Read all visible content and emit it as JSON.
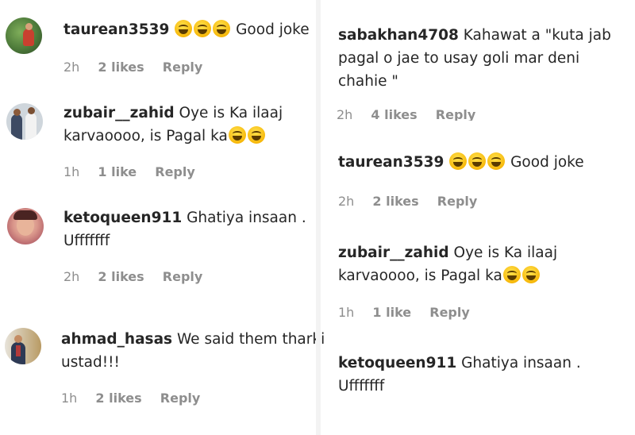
{
  "left": [
    {
      "user": "taurean3539",
      "emojis": 3,
      "text": "Good joke",
      "time": "2h",
      "likes": "2 likes",
      "reply": "Reply"
    },
    {
      "user": "zubair__zahid",
      "text_line1": "Oye is Ka ilaaj",
      "text_line2": "karvaoooo, is Pagal ka",
      "emojis": 2,
      "time": "1h",
      "likes": "1 like",
      "reply": "Reply"
    },
    {
      "user": "ketoqueen911",
      "text_line1": "Ghatiya insaan .",
      "text_line2": "Ufffffff",
      "time": "2h",
      "likes": "2 likes",
      "reply": "Reply"
    },
    {
      "user": "ahmad_hasas",
      "text_line1": "We said them tharki",
      "text_line2": "ustad!!!",
      "time": "1h",
      "likes": "2 likes",
      "reply": "Reply"
    }
  ],
  "right": [
    {
      "user": "sabakhan4708",
      "text_line1": "Kahawat a \"kuta jab",
      "text_line2": "pagal o jae to usay goli mar deni",
      "text_line3": "chahie \"",
      "time": "2h",
      "likes": "4 likes",
      "reply": "Reply"
    },
    {
      "user": "taurean3539",
      "emojis": 3,
      "text": "Good joke",
      "time": "2h",
      "likes": "2 likes",
      "reply": "Reply"
    },
    {
      "user": "zubair__zahid",
      "text_line1": "Oye is Ka ilaaj",
      "text_line2": "karvaoooo, is Pagal ka",
      "emojis": 2,
      "time": "1h",
      "likes": "1 like",
      "reply": "Reply"
    },
    {
      "user": "ketoqueen911",
      "text_line1": "Ghatiya insaan .",
      "text_line2": "Ufffffff"
    }
  ]
}
